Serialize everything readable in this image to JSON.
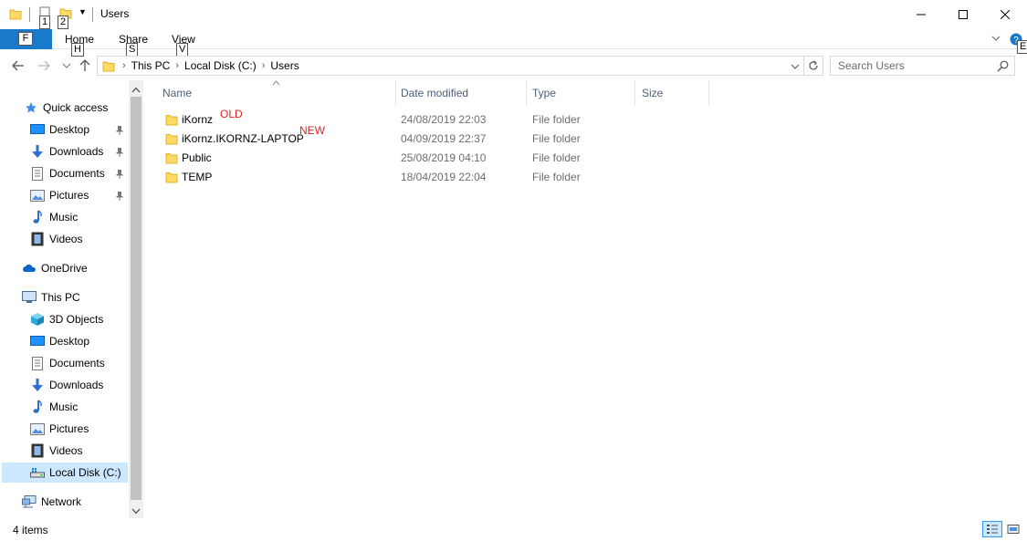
{
  "window": {
    "title": "Users"
  },
  "quick_access_toolbar": {
    "keytip_1": "1",
    "keytip_2": "2"
  },
  "ribbon": {
    "file_keytip": "F",
    "tabs": [
      {
        "label": "Home",
        "keytip": "H"
      },
      {
        "label": "Share",
        "keytip": "S"
      },
      {
        "label": "View",
        "keytip": "V"
      }
    ],
    "help_keytip": "E"
  },
  "address_bar": {
    "path": [
      "This PC",
      "Local Disk (C:)",
      "Users"
    ]
  },
  "search": {
    "placeholder": "Search Users"
  },
  "nav_pane": {
    "quick_access": {
      "label": "Quick access",
      "items": [
        {
          "label": "Desktop",
          "icon": "desktop-icon",
          "pinned": true
        },
        {
          "label": "Downloads",
          "icon": "downloads-icon",
          "pinned": true
        },
        {
          "label": "Documents",
          "icon": "documents-icon",
          "pinned": true
        },
        {
          "label": "Pictures",
          "icon": "pictures-icon",
          "pinned": true
        },
        {
          "label": "Music",
          "icon": "music-icon",
          "pinned": false
        },
        {
          "label": "Videos",
          "icon": "videos-icon",
          "pinned": false
        }
      ]
    },
    "onedrive": {
      "label": "OneDrive"
    },
    "this_pc": {
      "label": "This PC",
      "items": [
        {
          "label": "3D Objects",
          "icon": "3d-objects-icon"
        },
        {
          "label": "Desktop",
          "icon": "desktop-icon"
        },
        {
          "label": "Documents",
          "icon": "documents-icon"
        },
        {
          "label": "Downloads",
          "icon": "downloads-icon"
        },
        {
          "label": "Music",
          "icon": "music-icon"
        },
        {
          "label": "Pictures",
          "icon": "pictures-icon"
        },
        {
          "label": "Videos",
          "icon": "videos-icon"
        },
        {
          "label": "Local Disk (C:)",
          "icon": "drive-icon",
          "selected": true
        }
      ]
    },
    "network": {
      "label": "Network"
    }
  },
  "file_list": {
    "columns": [
      {
        "label": "Name"
      },
      {
        "label": "Date modified"
      },
      {
        "label": "Type"
      },
      {
        "label": "Size"
      }
    ],
    "rows": [
      {
        "name": "iKornz",
        "date": "24/08/2019 22:03",
        "type": "File folder"
      },
      {
        "name": "iKornz.IKORNZ-LAPTOP",
        "date": "04/09/2019 22:37",
        "type": "File folder"
      },
      {
        "name": "Public",
        "date": "25/08/2019 04:10",
        "type": "File folder"
      },
      {
        "name": "TEMP",
        "date": "18/04/2019 22:04",
        "type": "File folder"
      }
    ],
    "annotations": {
      "old": "OLD",
      "new": "NEW"
    }
  },
  "status_bar": {
    "item_count": "4 items"
  },
  "colors": {
    "file_tab": "#1979ca",
    "folder": "#ffd966",
    "annotation": "#e02020",
    "selected_bg": "#cce8ff"
  }
}
